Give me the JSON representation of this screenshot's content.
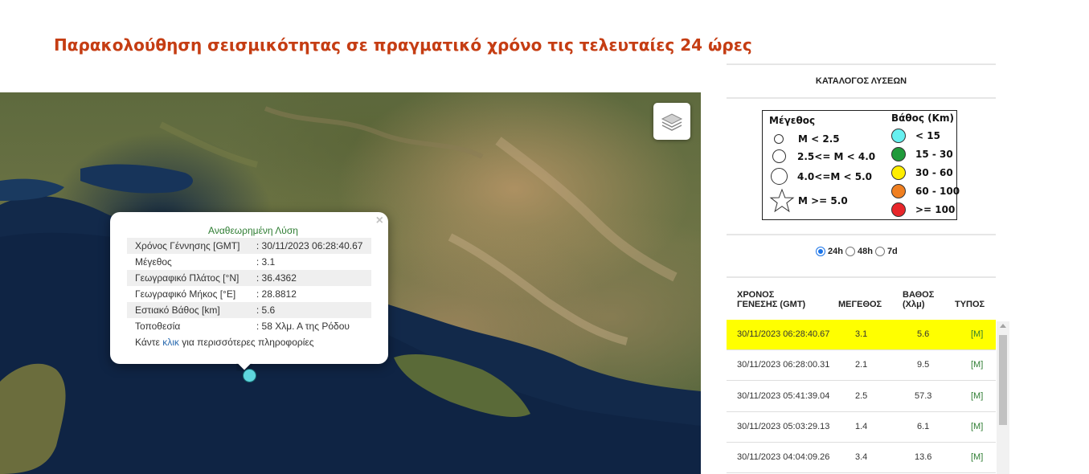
{
  "page": {
    "title": "Παρακολούθηση σεισμικότητας σε πραγματικό χρόνο τις τελευταίες 24 ώρες"
  },
  "map": {
    "layers_icon": "layers-icon",
    "marker_color": "#5fd6de"
  },
  "popup": {
    "heading": "Αναθεωρημένη Λύση",
    "close": "×",
    "rows": [
      {
        "label": "Χρόνος Γέννησης [GMT]",
        "value": ": 30/11/2023 06:28:40.67"
      },
      {
        "label": "Μέγεθος",
        "value": ": 3.1"
      },
      {
        "label": "Γεωγραφικό Πλάτος [°N]",
        "value": ": 36.4362"
      },
      {
        "label": "Γεωγραφικό Μήκος [°E]",
        "value": ": 28.8812"
      },
      {
        "label": "Εστιακό Βάθος [km]",
        "value": ": 5.6"
      },
      {
        "label": "Τοποθεσία",
        "value": ": 58 Χλμ. Α της Ρόδου"
      }
    ],
    "footer_prefix": "Κάντε ",
    "footer_link": "κλικ",
    "footer_suffix": " για περισσότερες πληροφορίες"
  },
  "panel": {
    "title": "ΚΑΤΑΛΟΓΟΣ ΛΥΣΕΩΝ"
  },
  "legend": {
    "magnitude_title": "Μέγεθος",
    "depth_title": "Βάθος (Km)",
    "magnitudes": [
      "M < 2.5",
      "2.5<= M < 4.0",
      "4.0<=M < 5.0",
      "M >= 5.0"
    ],
    "depths": [
      {
        "label": "< 15",
        "color": "#66f0f0"
      },
      {
        "label": "15 - 30",
        "color": "#1f9a3a"
      },
      {
        "label": "30 - 60",
        "color": "#ffee00"
      },
      {
        "label": "60 - 100",
        "color": "#f07f20"
      },
      {
        "label": ">= 100",
        "color": "#e8262a"
      }
    ]
  },
  "time_filter": {
    "options": [
      "24h",
      "48h",
      "7d"
    ],
    "selected": "24h"
  },
  "event_list": {
    "headers": {
      "origin_line1": "ΧΡΟΝΟΣ",
      "origin_line2": "ΓΕΝΕΣΗΣ (GMT)",
      "magnitude": "ΜΕΓΕΘΟΣ",
      "depth_line1": "ΒΑΘΟΣ",
      "depth_line2": "(Χλμ)",
      "type": "ΤΥΠΟΣ"
    },
    "rows": [
      {
        "time": "30/11/2023 06:28:40.67",
        "mag": "3.1",
        "depth": "5.6",
        "type": "[M]",
        "selected": true
      },
      {
        "time": "30/11/2023 06:28:00.31",
        "mag": "2.1",
        "depth": "9.5",
        "type": "[M]",
        "selected": false
      },
      {
        "time": "30/11/2023 05:41:39.04",
        "mag": "2.5",
        "depth": "57.3",
        "type": "[M]",
        "selected": false
      },
      {
        "time": "30/11/2023 05:03:29.13",
        "mag": "1.4",
        "depth": "6.1",
        "type": "[M]",
        "selected": false
      },
      {
        "time": "30/11/2023 04:04:09.26",
        "mag": "3.4",
        "depth": "13.6",
        "type": "[M]",
        "selected": false
      }
    ]
  }
}
